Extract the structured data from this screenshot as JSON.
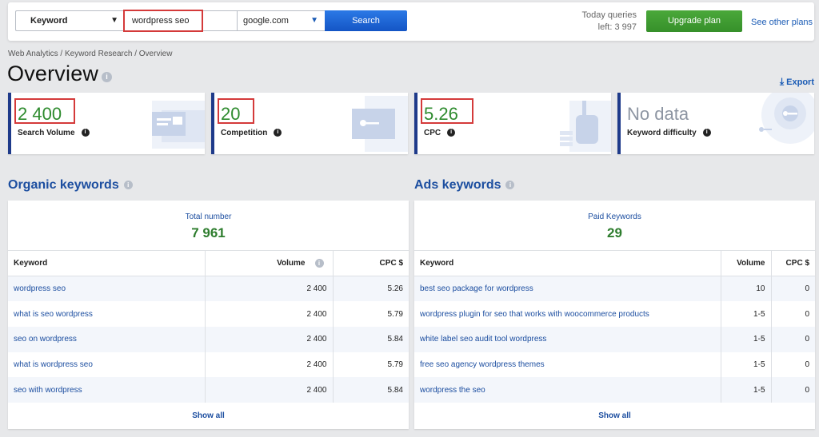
{
  "search": {
    "type_label": "Keyword",
    "query_value": "wordpress seo",
    "domain_label": "google.com",
    "search_button": "Search"
  },
  "header": {
    "queries_line1": "Today queries",
    "queries_line2": "left: 3 997",
    "upgrade_button": "Upgrade plan",
    "other_plans_link": "See other plans"
  },
  "breadcrumb": "Web Analytics / Keyword Research / Overview",
  "page_title": "Overview",
  "export_label": "Export",
  "kpis": [
    {
      "value": "2 400",
      "label": "Search Volume"
    },
    {
      "value": "20",
      "label": "Competition"
    },
    {
      "value": "5.26",
      "label": "CPC"
    },
    {
      "value": "No data",
      "label": "Keyword difficulty"
    }
  ],
  "organic": {
    "title": "Organic keywords",
    "total_label": "Total number",
    "total_value": "7 961",
    "columns": [
      "Keyword",
      "Volume",
      "CPC $"
    ],
    "rows": [
      {
        "keyword": "wordpress seo",
        "volume": "2 400",
        "cpc": "5.26"
      },
      {
        "keyword": "what is seo wordpress",
        "volume": "2 400",
        "cpc": "5.79"
      },
      {
        "keyword": "seo on wordpress",
        "volume": "2 400",
        "cpc": "5.84"
      },
      {
        "keyword": "what is wordpress seo",
        "volume": "2 400",
        "cpc": "5.79"
      },
      {
        "keyword": "seo with wordpress",
        "volume": "2 400",
        "cpc": "5.84"
      }
    ],
    "show_all": "Show all"
  },
  "ads": {
    "title": "Ads keywords",
    "total_label": "Paid Keywords",
    "total_value": "29",
    "columns": [
      "Keyword",
      "Volume",
      "CPC $"
    ],
    "rows": [
      {
        "keyword": "best seo package for wordpress",
        "volume": "10",
        "cpc": "0"
      },
      {
        "keyword": "wordpress plugin for seo that works with woocommerce products",
        "volume": "1-5",
        "cpc": "0"
      },
      {
        "keyword": "white label seo audit tool wordpress",
        "volume": "1-5",
        "cpc": "0"
      },
      {
        "keyword": "free seo agency wordpress themes",
        "volume": "1-5",
        "cpc": "0"
      },
      {
        "keyword": "wordpress the seo",
        "volume": "1-5",
        "cpc": "0"
      }
    ],
    "show_all": "Show all"
  }
}
